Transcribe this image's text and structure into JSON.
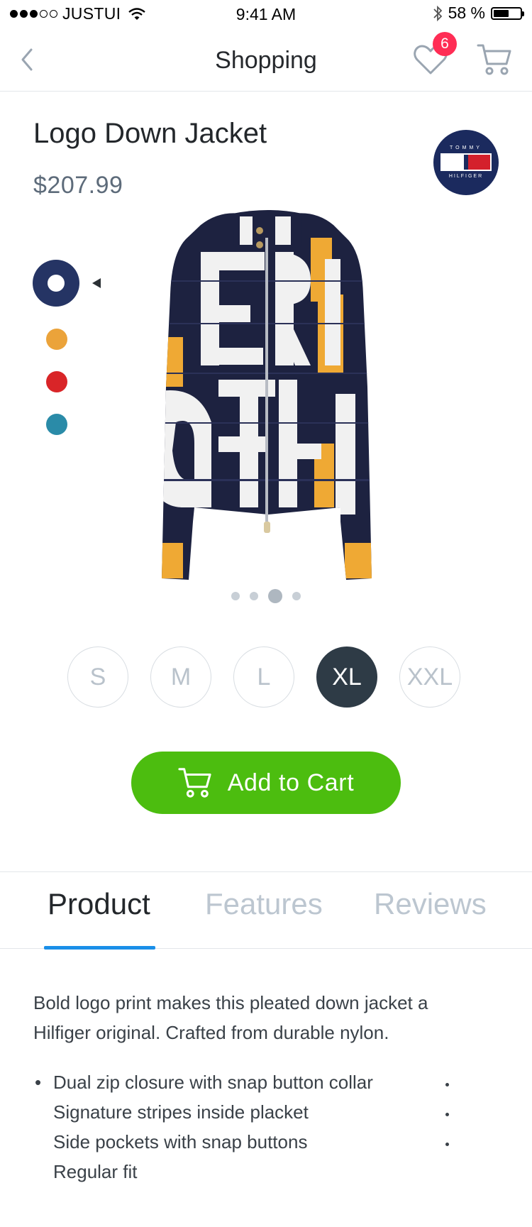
{
  "status_bar": {
    "carrier": "JUSTUI",
    "time": "9:41 AM",
    "battery": "58 %",
    "battery_level": 0.58
  },
  "nav": {
    "title": "Shopping",
    "wishlist_count": "6"
  },
  "product": {
    "title": "Logo Down Jacket",
    "price": "$207.99",
    "brand_top": "TOMMY",
    "brand_bottom": "HILFIGER",
    "colors": [
      {
        "name": "navy",
        "hex": "#253464",
        "selected": true
      },
      {
        "name": "yellow",
        "hex": "#eba33a",
        "selected": false
      },
      {
        "name": "red",
        "hex": "#d92528",
        "selected": false
      },
      {
        "name": "teal",
        "hex": "#2a8ba8",
        "selected": false
      }
    ],
    "image_pages": 4,
    "image_active_page": 3
  },
  "sizes": [
    {
      "label": "S",
      "selected": false
    },
    {
      "label": "M",
      "selected": false
    },
    {
      "label": "L",
      "selected": false
    },
    {
      "label": "XL",
      "selected": true
    },
    {
      "label": "XXL",
      "selected": false
    }
  ],
  "cart_button": {
    "label": "Add to Cart",
    "color": "#4cbd0f"
  },
  "tabs": [
    {
      "label": "Product",
      "active": true
    },
    {
      "label": "Features",
      "active": false
    },
    {
      "label": "Reviews",
      "active": false
    }
  ],
  "details": {
    "description": "Bold logo print makes this pleated down jacket a Hilfiger original. Crafted from durable nylon.",
    "bullets": [
      "Dual zip closure with snap button collar",
      "Signature stripes inside placket",
      "Side pockets with snap buttons",
      "Regular fit"
    ]
  },
  "colors": {
    "accent": "#1a8fe8",
    "badge": "#ff2d55",
    "size_selected": "#2e3b46"
  }
}
